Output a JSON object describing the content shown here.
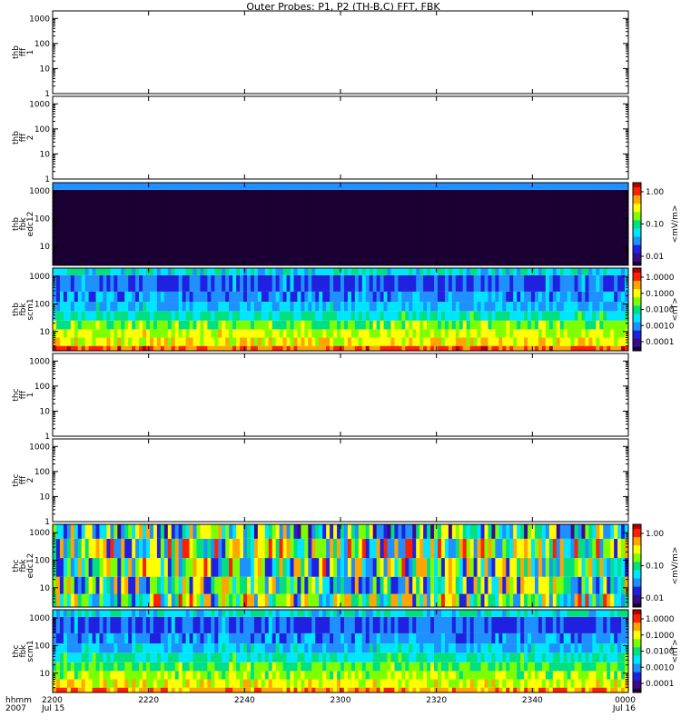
{
  "title": "Outer Probes: P1, P2 (TH-B,C) FFT, FBK",
  "x_axis": {
    "row_label_1": "hhmm",
    "row_label_2": "2007",
    "ticks": [
      {
        "label": "2200",
        "date": "Jul 15",
        "minute": 0
      },
      {
        "label": "2220",
        "date": "",
        "minute": 20
      },
      {
        "label": "2240",
        "date": "",
        "minute": 40
      },
      {
        "label": "2300",
        "date": "",
        "minute": 60
      },
      {
        "label": "2320",
        "date": "",
        "minute": 80
      },
      {
        "label": "2340",
        "date": "",
        "minute": 100
      },
      {
        "label": "0000",
        "date": "Jul 16",
        "minute": 120
      }
    ],
    "range_minutes": [
      0,
      120
    ]
  },
  "colors": {
    "colorbar": [
      "#1a0033",
      "#3a0a8a",
      "#2020e0",
      "#1e90ff",
      "#00e5ff",
      "#00e080",
      "#7cff00",
      "#ffff00",
      "#ffa500",
      "#ff2000",
      "#b00000"
    ]
  },
  "chart_data": [
    {
      "type": "heatmap",
      "name": "thb_fff_1",
      "ylabel": [
        "thb",
        "fff",
        "1"
      ],
      "ylim": [
        1,
        2000
      ],
      "yscale": "log",
      "yticks": [
        "1",
        "10",
        "100",
        "1000"
      ],
      "has_data": false,
      "colorbar": null
    },
    {
      "type": "heatmap",
      "name": "thb_fff_2",
      "ylabel": [
        "thb",
        "fff",
        "2"
      ],
      "ylim": [
        1,
        2000
      ],
      "yscale": "log",
      "yticks": [
        "1",
        "10",
        "100",
        "1000"
      ],
      "has_data": false,
      "colorbar": null
    },
    {
      "type": "heatmap",
      "name": "thb_fbk_edc12",
      "ylabel": [
        "thb",
        "fbk",
        "edc12"
      ],
      "ylim": [
        2,
        2000
      ],
      "yscale": "log",
      "yticks": [
        "10",
        "100",
        "1000"
      ],
      "has_data": true,
      "bands": [
        {
          "from": 2,
          "to": 1100,
          "level": 0.0
        },
        {
          "from": 1100,
          "to": 2000,
          "level": 0.28
        }
      ],
      "variability": 0.02,
      "colorbar": {
        "label": "<mV/m>",
        "ticks": [
          "1.00",
          "0.10",
          "0.01"
        ]
      }
    },
    {
      "type": "heatmap",
      "name": "thb_fbk_scm1",
      "ylabel": [
        "thb",
        "fbk",
        "scm1"
      ],
      "ylim": [
        2,
        2000
      ],
      "yscale": "log",
      "yticks": [
        "10",
        "100",
        "1000"
      ],
      "has_data": true,
      "bands": [
        {
          "from": 2,
          "to": 3,
          "level": 0.86
        },
        {
          "from": 3,
          "to": 6,
          "level": 0.7
        },
        {
          "from": 6,
          "to": 12,
          "level": 0.66
        },
        {
          "from": 12,
          "to": 25,
          "level": 0.58
        },
        {
          "from": 25,
          "to": 55,
          "level": 0.46
        },
        {
          "from": 55,
          "to": 120,
          "level": 0.36
        },
        {
          "from": 120,
          "to": 280,
          "level": 0.3
        },
        {
          "from": 280,
          "to": 1100,
          "level": 0.26
        },
        {
          "from": 1100,
          "to": 2000,
          "level": 0.42
        }
      ],
      "variability": 0.1,
      "colorbar": {
        "label": "<nT>",
        "ticks": [
          "1.0000",
          "0.1000",
          "0.0100",
          "0.0010",
          "0.0001"
        ]
      }
    },
    {
      "type": "heatmap",
      "name": "thc_fff_1",
      "ylabel": [
        "thc",
        "fff",
        "1"
      ],
      "ylim": [
        1,
        2000
      ],
      "yscale": "log",
      "yticks": [
        "1",
        "10",
        "100",
        "1000"
      ],
      "has_data": false,
      "colorbar": null
    },
    {
      "type": "heatmap",
      "name": "thc_fff_2",
      "ylabel": [
        "thc",
        "fff",
        "2"
      ],
      "ylim": [
        1,
        2000
      ],
      "yscale": "log",
      "yticks": [
        "1",
        "10",
        "100",
        "1000"
      ],
      "has_data": false,
      "colorbar": null
    },
    {
      "type": "heatmap",
      "name": "thc_fbk_edc12",
      "ylabel": [
        "thc",
        "fbk",
        "edc12"
      ],
      "ylim": [
        2,
        2000
      ],
      "yscale": "log",
      "yticks": [
        "10",
        "100",
        "1000"
      ],
      "has_data": true,
      "bands": [
        {
          "from": 2,
          "to": 6,
          "level": 0.55
        },
        {
          "from": 6,
          "to": 25,
          "level": 0.5
        },
        {
          "from": 25,
          "to": 120,
          "level": 0.52
        },
        {
          "from": 120,
          "to": 600,
          "level": 0.55
        },
        {
          "from": 600,
          "to": 2000,
          "level": 0.42
        }
      ],
      "variability": 0.35,
      "colorbar": {
        "label": "<mV/m>",
        "ticks": [
          "1.00",
          "0.10",
          "0.01"
        ]
      }
    },
    {
      "type": "heatmap",
      "name": "thc_fbk_scm1",
      "ylabel": [
        "thc",
        "fbk",
        "scm1"
      ],
      "ylim": [
        2,
        2000
      ],
      "yscale": "log",
      "yticks": [
        "10",
        "100",
        "1000"
      ],
      "has_data": true,
      "bands": [
        {
          "from": 2,
          "to": 3,
          "level": 0.8
        },
        {
          "from": 3,
          "to": 6,
          "level": 0.68
        },
        {
          "from": 6,
          "to": 12,
          "level": 0.62
        },
        {
          "from": 12,
          "to": 25,
          "level": 0.56
        },
        {
          "from": 25,
          "to": 55,
          "level": 0.46
        },
        {
          "from": 55,
          "to": 120,
          "level": 0.36
        },
        {
          "from": 120,
          "to": 280,
          "level": 0.3
        },
        {
          "from": 280,
          "to": 1100,
          "level": 0.26
        },
        {
          "from": 1100,
          "to": 2000,
          "level": 0.42
        }
      ],
      "variability": 0.1,
      "colorbar": {
        "label": "<nT>",
        "ticks": [
          "1.0000",
          "0.1000",
          "0.0100",
          "0.0010",
          "0.0001"
        ]
      }
    }
  ]
}
